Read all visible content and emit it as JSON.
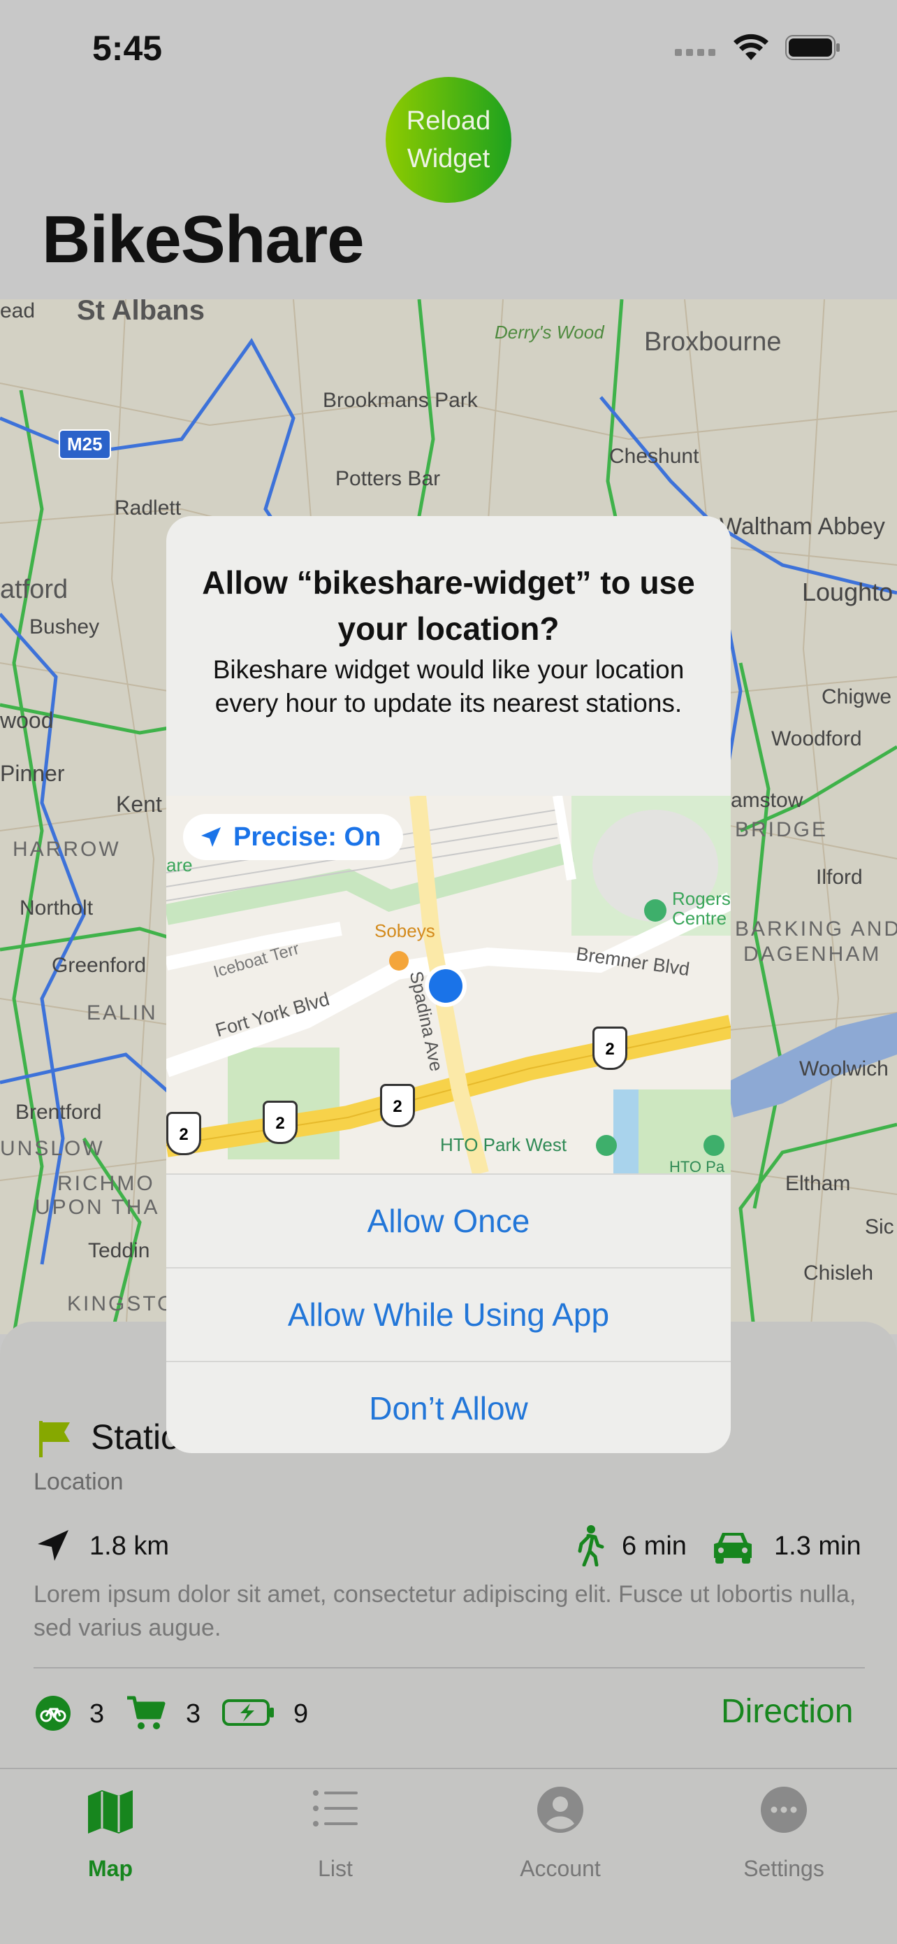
{
  "status_bar": {
    "time": "5:45"
  },
  "header": {
    "reload_line1": "Reload",
    "reload_line2": "Widget",
    "title": "BikeShare"
  },
  "map_labels": {
    "st_albans": "St Albans",
    "derrys_wood": "Derry's Wood",
    "broxbourne": "Broxbourne",
    "brookmans_park": "Brookmans Park",
    "m25": "M25",
    "cheshunt": "Cheshunt",
    "potters_bar": "Potters Bar",
    "radlett": "Radlett",
    "waltham_abbey": "Waltham Abbey",
    "atford": "atford",
    "bushey": "Bushey",
    "loughton": "Loughto",
    "chigwell": "Chigwe",
    "woodford": "Woodford",
    "wood": "wood",
    "pinner": "Pinner",
    "kent": "Kent",
    "harrow": "HARROW",
    "walthamstow": "amstow",
    "bridge": "BRIDGE",
    "ilford": "Ilford",
    "northolt": "Northolt",
    "barking": "BARKING AND",
    "dagenham": "DAGENHAM",
    "greenford": "Greenford",
    "ealing": "EALIN",
    "woolwich": "Woolwich",
    "brentford": "Brentford",
    "unslow": "UNSLOW",
    "richmond": "RICHMO",
    "upon_thames": "UPON THA",
    "eltham": "Eltham",
    "teddington": "Teddin",
    "sid": "Sic",
    "chislehurst": "Chisleh",
    "kingston": "KINGSTO",
    "ead": "ead"
  },
  "alert": {
    "title": "Allow “bikeshare-widget” to use your location?",
    "message": "Bikeshare widget would like your location every hour to update its nearest stations.",
    "precise": "Precise: On",
    "map_labels": {
      "sobeys": "Sobeys",
      "iceboat": "Iceboat Terr",
      "fort_york": "Fort York Blvd",
      "bremner": "Bremner Blvd",
      "spadina": "Spadina Ave",
      "rogers": "Rogers",
      "centre": "Centre",
      "hto_park_west": "HTO Park West",
      "hto_park": "HTO Pa",
      "highway": "2",
      "are": "are"
    },
    "buttons": [
      "Allow Once",
      "Allow While Using App",
      "Don’t Allow"
    ]
  },
  "station": {
    "title": "Statio",
    "location_label": "Location",
    "distance": "1.8 km",
    "walk_time": "6 min",
    "drive_time": "1.3 min",
    "description": "Lorem ipsum dolor sit amet, consectetur adipiscing elit. Fusce ut lobortis nulla, sed varius augue.",
    "bikes": "3",
    "docks": "3",
    "ebikes": "9",
    "direction_label": "Direction"
  },
  "tabs": [
    {
      "label": "Map",
      "icon": "map-icon",
      "active": true
    },
    {
      "label": "List",
      "icon": "list-icon",
      "active": false
    },
    {
      "label": "Account",
      "icon": "account-icon",
      "active": false
    },
    {
      "label": "Settings",
      "icon": "settings-icon",
      "active": false
    }
  ],
  "colors": {
    "accent": "#17861e",
    "alert_blue": "#2276d8",
    "reload_start": "#8ecb00",
    "reload_end": "#1ea21e"
  }
}
